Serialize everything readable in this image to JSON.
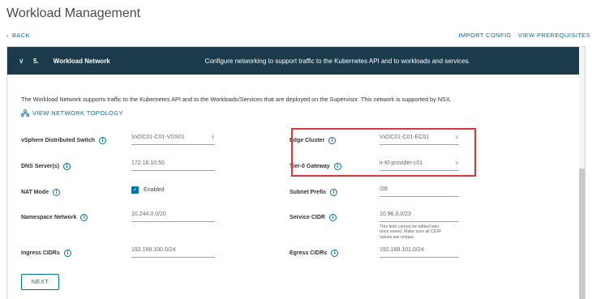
{
  "page": {
    "title": "Workload Management"
  },
  "nav": {
    "back": "BACK",
    "import_config": "IMPORT CONFIG",
    "view_prerequisites": "VIEW PREREQUISITES"
  },
  "step": {
    "number": "5.",
    "title": "Workload Network",
    "description": "Configure networking to support traffic to the Kubernetes API and to workloads and services."
  },
  "intro": {
    "text": "The Workload Network supports traffic to the Kubernetes API and to the Workloads/Services that are deployed on the Supervisor. This network is supported by NSX.",
    "topology_link": "VIEW NETWORK TOPOLOGY"
  },
  "form": {
    "vds": {
      "label": "vSphere Distributed Switch",
      "value": "VxDC01-C01-VDS01"
    },
    "dns": {
      "label": "DNS Server(s)",
      "value": "172.16.10.50"
    },
    "nat": {
      "label": "NAT Mode",
      "value": "Enabled",
      "checked": true
    },
    "namespace": {
      "label": "Namespace Network",
      "value": "10.244.0.0/20"
    },
    "ingress": {
      "label": "Ingress CIDRs",
      "value": "192.168.100.0/24"
    },
    "edge_cluster": {
      "label": "Edge Cluster",
      "value": "VxDC01-C01-EC01"
    },
    "tier0": {
      "label": "Tier-0 Gateway",
      "value": "lr-t0-provider-c01"
    },
    "subnet_prefix": {
      "label": "Subnet Prefix",
      "value": "/28"
    },
    "service_cidr": {
      "label": "Service CIDR",
      "value": "10.96.0.0/23",
      "hint_line1": "This field cannot be edited later",
      "hint_line2": "once saved. Make sure all CIDR",
      "hint_line3": "values are unique."
    },
    "egress": {
      "label": "Egress CIDRs",
      "value": "192.168.101.0/24"
    }
  },
  "actions": {
    "next": "NEXT"
  },
  "colors": {
    "accent": "#0072a3",
    "header_bg": "#1b3a4b",
    "highlight": "#d9373d"
  }
}
